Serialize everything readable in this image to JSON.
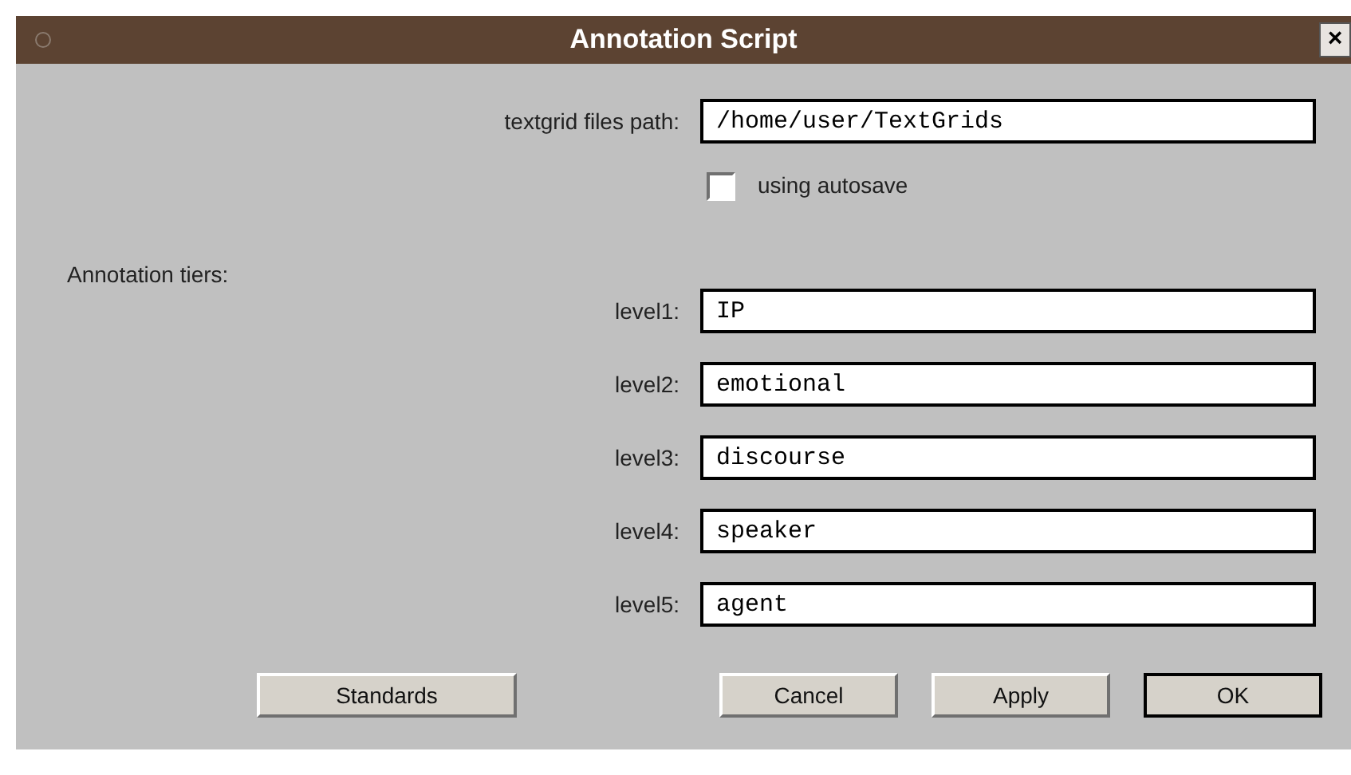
{
  "window": {
    "title": "Annotation Script",
    "close": "×"
  },
  "path": {
    "label": "textgrid files path:",
    "value": "/home/user/TextGrids"
  },
  "autosave": {
    "label": "using autosave",
    "checked": false
  },
  "tiers_heading": "Annotation tiers:",
  "tiers": [
    {
      "label": "level1:",
      "value": "IP"
    },
    {
      "label": "level2:",
      "value": "emotional"
    },
    {
      "label": "level3:",
      "value": "discourse"
    },
    {
      "label": "level4:",
      "value": "speaker"
    },
    {
      "label": "level5:",
      "value": "agent"
    }
  ],
  "buttons": [
    {
      "label": "Standards",
      "default": false
    },
    {
      "label": "Cancel",
      "default": false
    },
    {
      "label": "Apply",
      "default": false
    },
    {
      "label": "OK",
      "default": true
    }
  ]
}
